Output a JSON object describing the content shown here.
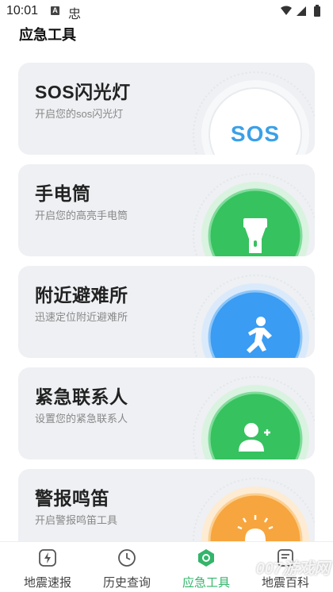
{
  "status_bar": {
    "time": "10:01",
    "notif_letter": "A",
    "notif_glyph": "忠"
  },
  "page_title": "应急工具",
  "cards": [
    {
      "title": "SOS闪光灯",
      "subtitle": "开启您的sos闪光灯",
      "icon": "sos-icon",
      "icon_text": "SOS",
      "theme": "#ffffff",
      "accent": "#3aa0e8"
    },
    {
      "title": "手电筒",
      "subtitle": "开启您的高亮手电筒",
      "icon": "flashlight-icon",
      "theme": "#36c25f",
      "accent": "#ffffff"
    },
    {
      "title": "附近避难所",
      "subtitle": "迅速定位附近避难所",
      "icon": "running-person-icon",
      "theme": "#3a9cf2",
      "accent": "#ffffff"
    },
    {
      "title": "紧急联系人",
      "subtitle": "设置您的紧急联系人",
      "icon": "add-contact-icon",
      "theme": "#36c25f",
      "accent": "#ffffff"
    },
    {
      "title": "警报鸣笛",
      "subtitle": "开启警报鸣笛工具",
      "icon": "siren-icon",
      "theme": "#f7a53e",
      "accent": "#ffffff"
    }
  ],
  "bottom_nav": [
    {
      "label": "地震速报",
      "icon": "lightning-icon",
      "active": false
    },
    {
      "label": "历史查询",
      "icon": "clock-icon",
      "active": false
    },
    {
      "label": "应急工具",
      "icon": "toolbox-icon",
      "active": true
    },
    {
      "label": "地震百科",
      "icon": "book-icon",
      "active": false
    }
  ],
  "watermark": "007游戏网",
  "colors": {
    "active": "#33b56b",
    "inactive": "#444444",
    "card_bg": "#eef0f3"
  }
}
